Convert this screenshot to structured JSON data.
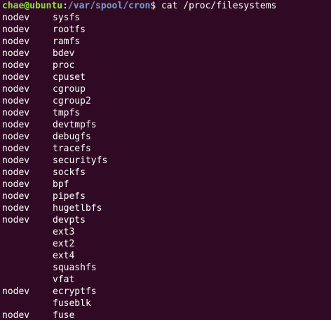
{
  "prompt": {
    "user_host": "chae@ubuntu",
    "colon": ":",
    "path": "/var/spool/cron",
    "dollar": "$",
    "command": " cat /proc/filesystems"
  },
  "filesystems": [
    {
      "flag": "nodev",
      "name": "sysfs"
    },
    {
      "flag": "nodev",
      "name": "rootfs"
    },
    {
      "flag": "nodev",
      "name": "ramfs"
    },
    {
      "flag": "nodev",
      "name": "bdev"
    },
    {
      "flag": "nodev",
      "name": "proc"
    },
    {
      "flag": "nodev",
      "name": "cpuset"
    },
    {
      "flag": "nodev",
      "name": "cgroup"
    },
    {
      "flag": "nodev",
      "name": "cgroup2"
    },
    {
      "flag": "nodev",
      "name": "tmpfs"
    },
    {
      "flag": "nodev",
      "name": "devtmpfs"
    },
    {
      "flag": "nodev",
      "name": "debugfs"
    },
    {
      "flag": "nodev",
      "name": "tracefs"
    },
    {
      "flag": "nodev",
      "name": "securityfs"
    },
    {
      "flag": "nodev",
      "name": "sockfs"
    },
    {
      "flag": "nodev",
      "name": "bpf"
    },
    {
      "flag": "nodev",
      "name": "pipefs"
    },
    {
      "flag": "nodev",
      "name": "hugetlbfs"
    },
    {
      "flag": "nodev",
      "name": "devpts"
    },
    {
      "flag": "",
      "name": "ext3"
    },
    {
      "flag": "",
      "name": "ext2"
    },
    {
      "flag": "",
      "name": "ext4"
    },
    {
      "flag": "",
      "name": "squashfs"
    },
    {
      "flag": "",
      "name": "vfat"
    },
    {
      "flag": "nodev",
      "name": "ecryptfs"
    },
    {
      "flag": "",
      "name": "fuseblk"
    },
    {
      "flag": "nodev",
      "name": "fuse"
    }
  ],
  "colors": {
    "background": "#300a24",
    "text": "#ffffff",
    "user_host": "#8ae234",
    "path": "#729fcf"
  }
}
